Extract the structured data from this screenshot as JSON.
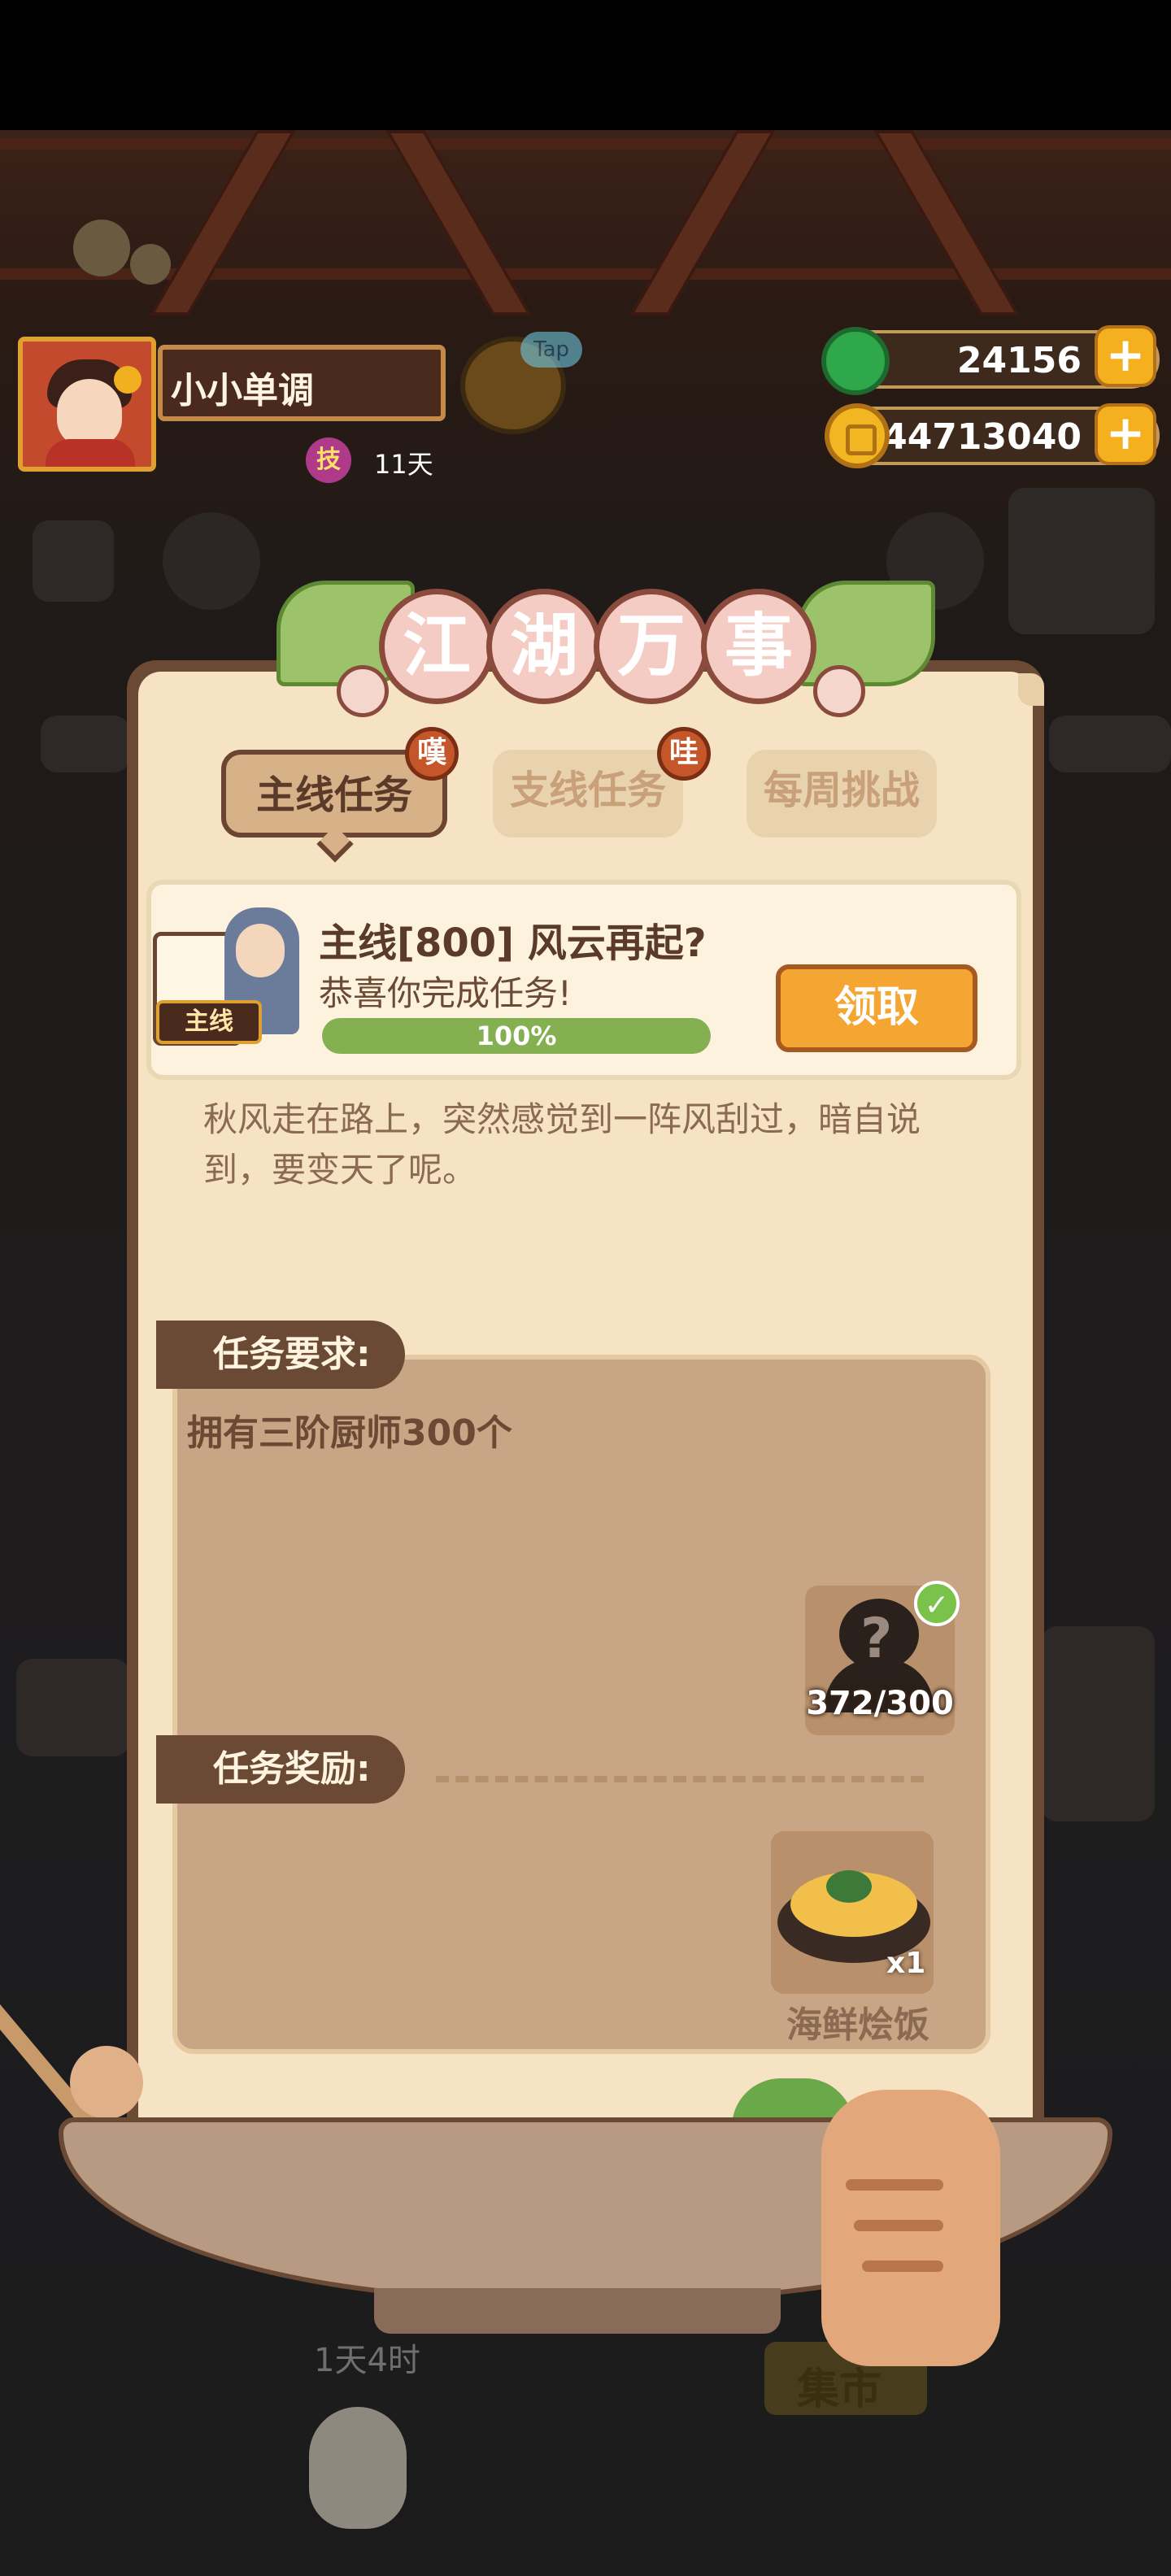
{
  "player": {
    "name": "小小单调",
    "skill_badge": "技",
    "days": "11天"
  },
  "tap_hint": "Tap",
  "resources": {
    "gems": "24156",
    "coins": "44713040",
    "plus": "+"
  },
  "dialog": {
    "title_chars": [
      "江",
      "湖",
      "万",
      "事"
    ],
    "tabs": [
      {
        "label": "主线任务",
        "badge": "嘆",
        "active": true
      },
      {
        "label": "支线任务",
        "badge": "哇",
        "active": false
      },
      {
        "label": "每周挑战",
        "active": false
      }
    ],
    "task": {
      "tag": "主线",
      "title": "主线[800] 风云再起?",
      "subtitle": "恭喜你完成任务!",
      "progress_percent": 100,
      "progress_label": "100%",
      "claim_label": "领取"
    },
    "description": "秋风走在路上，突然感觉到一阵风刮过，暗自说到，要变天了呢。",
    "requirement": {
      "label": "任务要求:",
      "text": "拥有三阶厨师300个",
      "count": "372/300",
      "unknown_mark": "?",
      "check": "✓"
    },
    "reward": {
      "label": "任务奖励:",
      "qty": "x1",
      "name": "海鲜烩饭"
    }
  },
  "background": {
    "timer": "1天4时",
    "market": "集市"
  },
  "colors": {
    "panel_bg": "#f6e3c4",
    "panel_border": "#6b4a35",
    "claim_button": "#f5a532",
    "progress_fill": "#84b052"
  }
}
